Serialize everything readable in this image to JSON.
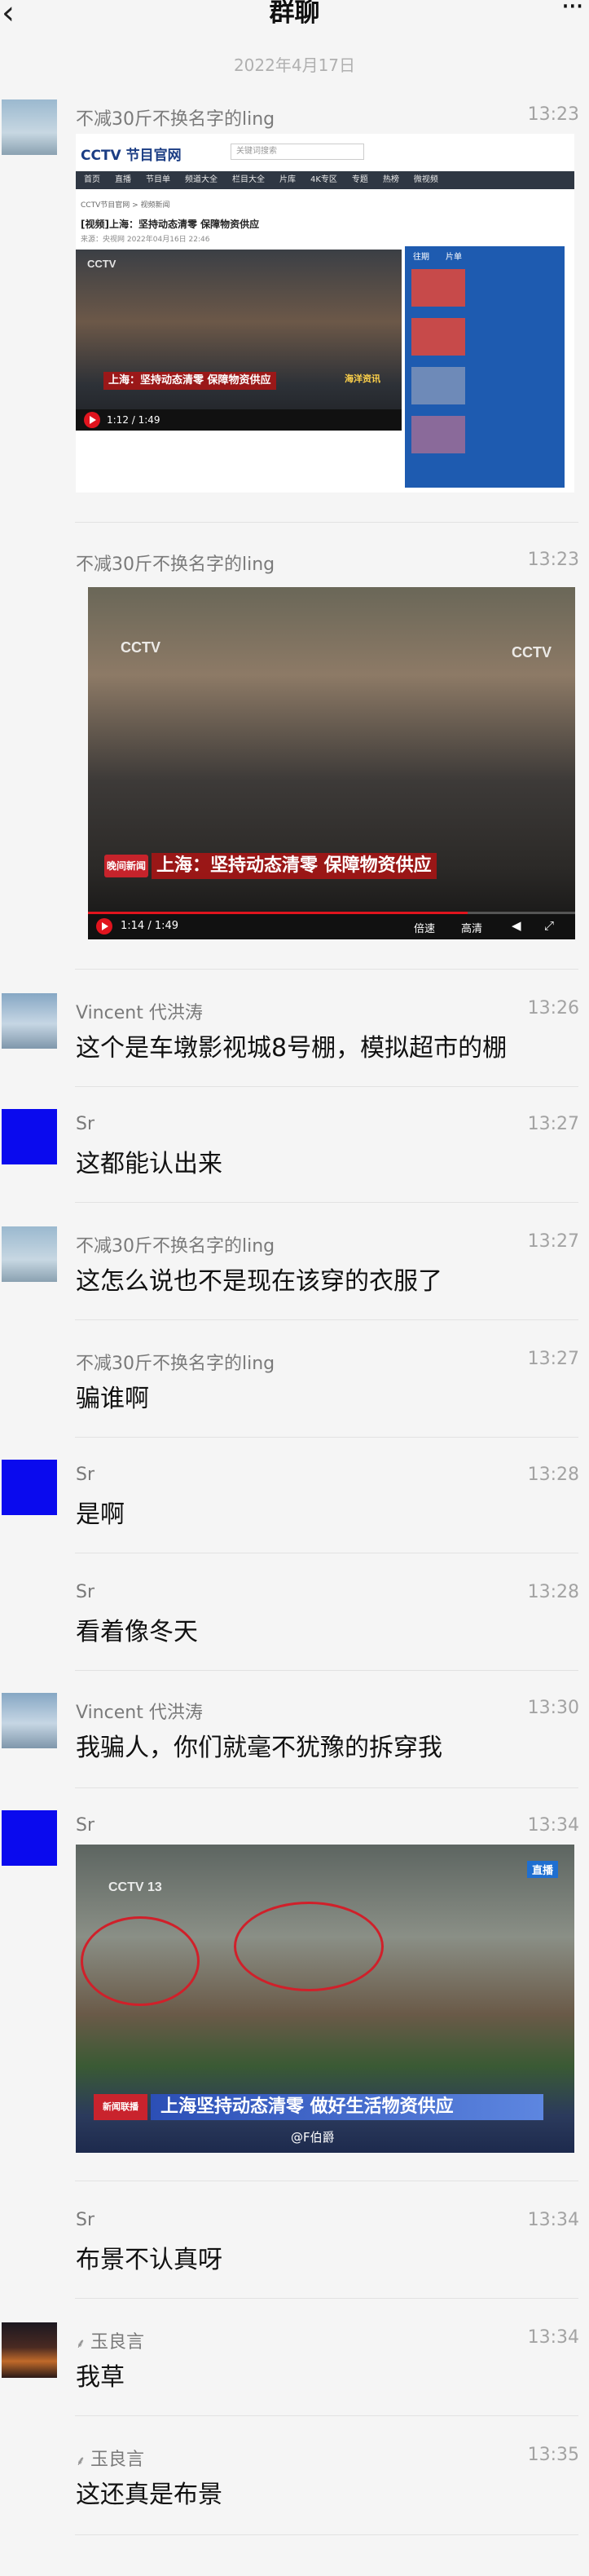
{
  "header": {
    "back_icon": "chevron-left-icon",
    "title": "群聊",
    "more_icon": "more-icon",
    "more_glyph": "···"
  },
  "date_label": "2022年4月17日",
  "screenshot1": {
    "logo": "CCTV 节目官网",
    "search_placeholder": "关键词搜索",
    "nav": [
      "首页",
      "直播",
      "节目单",
      "频道大全",
      "栏目大全",
      "片库",
      "4K专区",
      "专题",
      "热榜",
      "微视频"
    ],
    "breadcrumb": "CCTV节目官网 > 视频新闻",
    "headline": "[视频]上海：坚持动态清零 保障物资供应",
    "meta": "来源：央视网  2022年04月16日 22:46",
    "caption": "上海：坚持动态清零 保障物资供应",
    "subcaption": "海洋资讯",
    "player_time": "1:12 / 1:49",
    "side_tabs": [
      "往期",
      "片单"
    ]
  },
  "screenshot2": {
    "caption": "上海：坚持动态清零 保障物资供应",
    "badge": "晚间新闻",
    "player_time": "1:14 / 1:49",
    "quality": [
      "倍速",
      "高清"
    ]
  },
  "screenshot3": {
    "caption": "上海坚持动态清零 做好生活物资供应",
    "badge": "新闻联播",
    "live": "直播",
    "watermark": "@F伯爵"
  },
  "messages": [
    {
      "sender": "不减30斤不换名字的ling",
      "time": "13:23",
      "type": "image",
      "image": "screenshot1"
    },
    {
      "sender": "不减30斤不换名字的ling",
      "time": "13:23",
      "type": "image",
      "image": "screenshot2"
    },
    {
      "sender": "Vincent 代洪涛",
      "time": "13:26",
      "type": "text",
      "text": "这个是车墩影视城8号棚，模拟超市的棚"
    },
    {
      "sender": "Sr",
      "time": "13:27",
      "type": "text",
      "text": "这都能认出来"
    },
    {
      "sender": "不减30斤不换名字的ling",
      "time": "13:27",
      "type": "text",
      "text": "这怎么说也不是现在该穿的衣服了"
    },
    {
      "sender": "不减30斤不换名字的ling",
      "time": "13:27",
      "type": "text",
      "text": "骗谁啊"
    },
    {
      "sender": "Sr",
      "time": "13:28",
      "type": "text",
      "text": "是啊"
    },
    {
      "sender": "Sr",
      "time": "13:28",
      "type": "text",
      "text": "看着像冬天"
    },
    {
      "sender": "Vincent 代洪涛",
      "time": "13:30",
      "type": "text",
      "text": "我骗人，你们就毫不犹豫的拆穿我"
    },
    {
      "sender": "Sr",
      "time": "13:34",
      "type": "image",
      "image": "screenshot3"
    },
    {
      "sender": "Sr",
      "time": "13:34",
      "type": "text",
      "text": "布景不认真呀"
    },
    {
      "sender": "玉良言",
      "time": "13:34",
      "type": "text",
      "text": "我草"
    },
    {
      "sender": "玉良言",
      "time": "13:35",
      "type": "text",
      "text": "这还真是布景"
    }
  ]
}
